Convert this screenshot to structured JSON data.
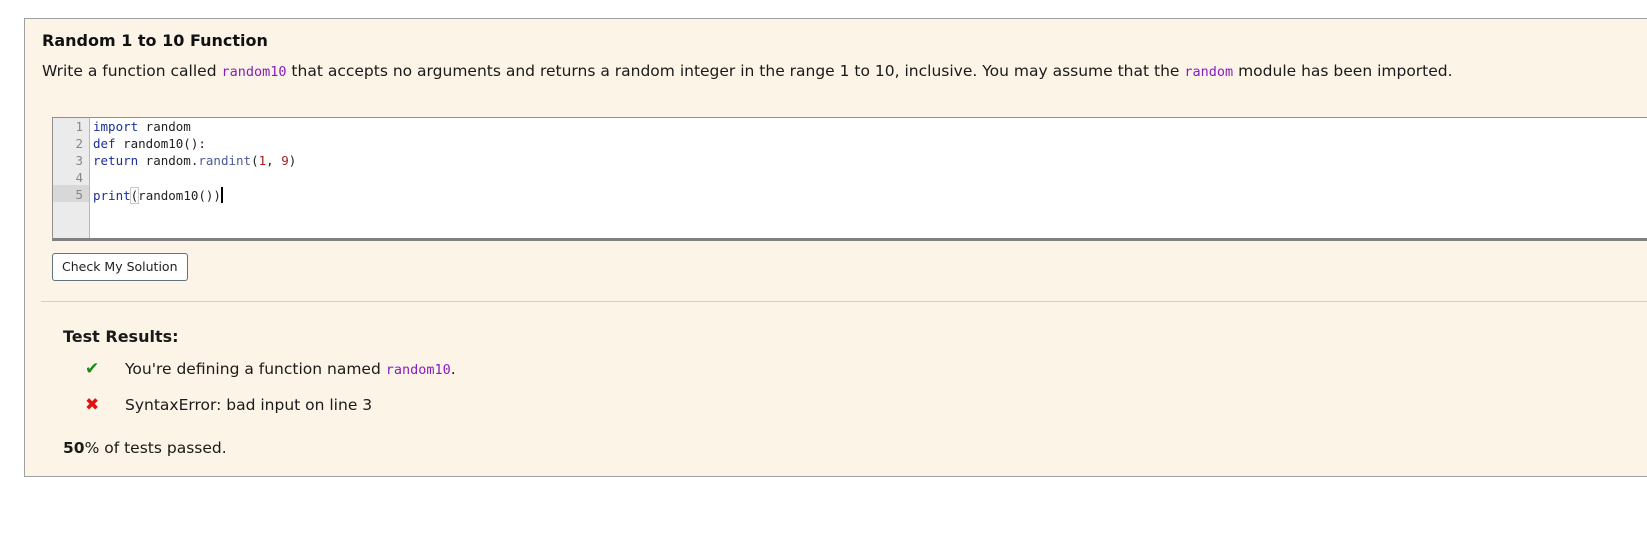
{
  "exercise": {
    "title": "Random 1 to 10 Function",
    "description": {
      "part1": "Write a function called ",
      "code1": "random10",
      "part2": " that accepts no arguments and returns a random integer in the range 1 to 10, inclusive. You may assume that the ",
      "code2": "random",
      "part3": " module has been imported."
    }
  },
  "editor": {
    "line_numbers": [
      "1",
      "2",
      "3",
      "4",
      "5"
    ],
    "active_line": 5,
    "lines": {
      "l1_kw": "import",
      "l1_rest": " random",
      "l2_kw": "def",
      "l2_rest": " random10():",
      "l3_kw": "return",
      "l3_a": " random.",
      "l3_fn": "randint",
      "l3_b": "(",
      "l3_n1": "1",
      "l3_c": ", ",
      "l3_n2": "9",
      "l3_d": ")",
      "l5_fn": "print",
      "l5_open": "(",
      "l5_rest": "random10())"
    }
  },
  "check_button": {
    "label": "Check My Solution"
  },
  "results": {
    "title": "Test Results:",
    "items": [
      {
        "status": "pass",
        "icon": "✔",
        "text": "You're defining a function named ",
        "code": "random10",
        "suffix": "."
      },
      {
        "status": "fail",
        "icon": "✖",
        "text": "SyntaxError: bad input on line 3"
      }
    ],
    "percent_passed": "50",
    "summary_suffix": "% of tests passed."
  },
  "colors": {
    "panel_bg": "#fcf4e6",
    "code_inline": "#8a1cc4",
    "pass": "#1b8a1b",
    "fail": "#e31212"
  }
}
